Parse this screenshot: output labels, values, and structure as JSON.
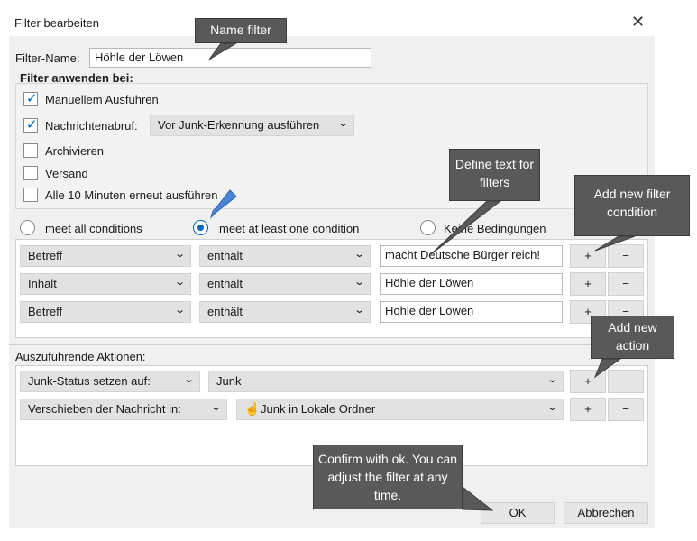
{
  "window": {
    "title": "Filter bearbeiten",
    "close_icon": "close-icon"
  },
  "filter_name": {
    "label": "Filter-Name:",
    "value": "Höhle der Löwen"
  },
  "apply": {
    "heading": "Filter anwenden bei:",
    "manual": "Manuellem Ausführen",
    "fetch": "Nachrichtenabruf:",
    "fetch_option": "Vor Junk-Erkennung ausführen",
    "archive": "Archivieren",
    "send": "Versand",
    "every10": "Alle 10 Minuten erneut ausführen"
  },
  "match": {
    "all": "meet all conditions",
    "any": "meet at least one condition",
    "none": "Keine Bedingungen"
  },
  "conditions": [
    {
      "field": "Betreff",
      "op": "enthält",
      "value": "macht Deutsche Bürger reich!"
    },
    {
      "field": "Inhalt",
      "op": "enthält",
      "value": "Höhle der Löwen"
    },
    {
      "field": "Betreff",
      "op": "enthält",
      "value": "Höhle der Löwen"
    }
  ],
  "actions_label": "Auszuführende Aktionen:",
  "actions": [
    {
      "action": "Junk-Status setzen auf:",
      "target": "Junk"
    },
    {
      "action": "Verschieben der Nachricht in:",
      "target": "Junk in Lokale Ordner"
    }
  ],
  "buttons": {
    "plus": "+",
    "minus": "−",
    "ok": "OK",
    "cancel": "Abbrechen"
  },
  "callouts": {
    "name": "Name filter",
    "define": "Define text for filters",
    "add_condition": "Add new filter condition",
    "add_action": "Add new action",
    "confirm": "Confirm with ok. You can adjust the filter at any time."
  },
  "colors": {
    "accent": "#0067c0",
    "callout_bg": "#595959",
    "dialog_bg": "#f0f0f0"
  }
}
